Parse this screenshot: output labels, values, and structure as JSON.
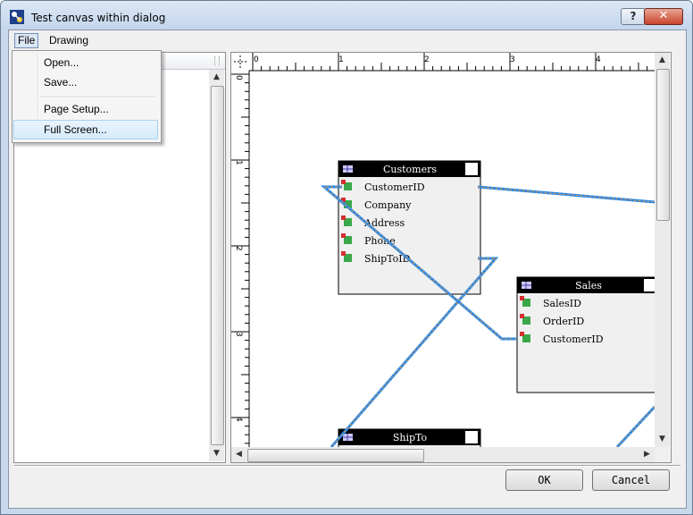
{
  "window": {
    "title": "Test canvas within dialog",
    "help_label": "?",
    "close_label": "✕"
  },
  "menu": {
    "file": "File",
    "drawing": "Drawing"
  },
  "file_menu": {
    "items": [
      "Open...",
      "Save...",
      "Page Setup...",
      "Full Screen..."
    ],
    "highlighted": "Full Screen..."
  },
  "ruler": {
    "horizontal_labels": [
      "0",
      "1",
      "2",
      "3",
      "4"
    ],
    "vertical_labels": [
      "0",
      "1",
      "2",
      "3",
      "4"
    ]
  },
  "tables": {
    "customers": {
      "title": "Customers",
      "fields": [
        "CustomerID",
        "Company",
        "Address",
        "Phone",
        "ShipToID"
      ]
    },
    "sales": {
      "title": "Sales",
      "fields": [
        "SalesID",
        "OrderID",
        "CustomerID"
      ]
    },
    "shipto": {
      "title": "ShipTo"
    }
  },
  "colors": {
    "link_blue": "#1f88f0",
    "link_orange": "#e8923a",
    "link_gray": "#9a9a9a"
  },
  "buttons": {
    "ok": "OK",
    "cancel": "Cancel"
  }
}
